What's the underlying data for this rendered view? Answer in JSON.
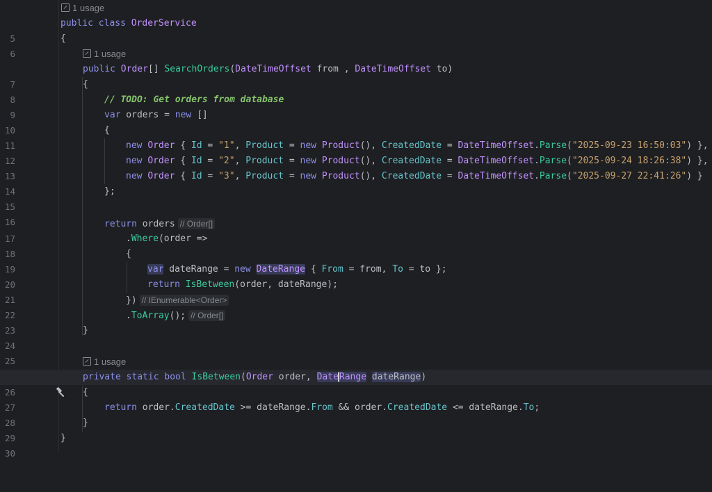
{
  "editor": {
    "usage_hint": "1 usage",
    "line_numbers": [
      "5",
      "6",
      "7",
      "8",
      "9",
      "10",
      "11",
      "12",
      "13",
      "14",
      "15",
      "16",
      "17",
      "18",
      "19",
      "20",
      "21",
      "22",
      "23",
      "24",
      "25",
      "26",
      "27",
      "28",
      "29",
      "30"
    ],
    "inlay_hints": {
      "orders_type": "// Order[]",
      "where_type": "// IEnumerable<Order>",
      "toarray_type": "// Order[]"
    },
    "gutter_icon": "hammer-icon",
    "colors": {
      "background": "#1e1f22",
      "keyword": "#8c8fe8",
      "type": "#c191ff",
      "method": "#39cc9b",
      "property": "#66c3cc",
      "string": "#c9a26d",
      "comment": "#85c46c"
    },
    "lines": {
      "l5": [
        "public class ",
        "OrderService"
      ],
      "l6": [
        "{"
      ],
      "l7": [
        "public ",
        "Order",
        "[] ",
        "SearchOrders",
        "(",
        "DateTimeOffset",
        " from , ",
        "DateTimeOffset",
        " to)"
      ],
      "l8": [
        "{"
      ],
      "l9": [
        "// TODO: Get orders from database"
      ],
      "l10": [
        "var",
        " orders = ",
        "new",
        " []"
      ],
      "l11": [
        "{"
      ],
      "l12": [
        "new ",
        "Order",
        " { ",
        "Id",
        " = ",
        "\"1\"",
        ", ",
        "Product",
        " = ",
        "new ",
        "Product",
        "(), ",
        "CreatedDate",
        " = ",
        "DateTimeOffset",
        ".",
        "Parse",
        "(",
        "\"2025-09-23 16:50:03\"",
        ") },"
      ],
      "l13": [
        "new ",
        "Order",
        " { ",
        "Id",
        " = ",
        "\"2\"",
        ", ",
        "Product",
        " = ",
        "new ",
        "Product",
        "(), ",
        "CreatedDate",
        " = ",
        "DateTimeOffset",
        ".",
        "Parse",
        "(",
        "\"2025-09-24 18:26:38\"",
        ") },"
      ],
      "l14": [
        "new ",
        "Order",
        " { ",
        "Id",
        " = ",
        "\"3\"",
        ", ",
        "Product",
        " = ",
        "new ",
        "Product",
        "(), ",
        "CreatedDate",
        " = ",
        "DateTimeOffset",
        ".",
        "Parse",
        "(",
        "\"2025-09-27 22:41:26\"",
        ") }"
      ],
      "l15": [
        "};"
      ],
      "l17": [
        "return",
        " orders"
      ],
      "l18": [
        ".",
        "Where",
        "(order =>"
      ],
      "l19": [
        "{"
      ],
      "l20": [
        "var",
        " dateRange = ",
        "new ",
        "DateRange",
        " { ",
        "From",
        " = from, ",
        "To",
        " = to };"
      ],
      "l21": [
        "return ",
        "IsBetween",
        "(order, dateRange);"
      ],
      "l22": [
        "})"
      ],
      "l23": [
        ".",
        "ToArray",
        "();"
      ],
      "l24": [
        "}"
      ],
      "l26": [
        "private static bool ",
        "IsBetween",
        "(",
        "Order",
        " order, ",
        "Date",
        "Range",
        " ",
        "dateRange",
        ")"
      ],
      "l27": [
        "{"
      ],
      "l28": [
        "return",
        " order.",
        "CreatedDate",
        " >= dateRange.",
        "From",
        " && order.",
        "CreatedDate",
        " <= dateRange.",
        "To",
        ";"
      ],
      "l29": [
        "}"
      ],
      "l30": [
        "}"
      ]
    }
  }
}
